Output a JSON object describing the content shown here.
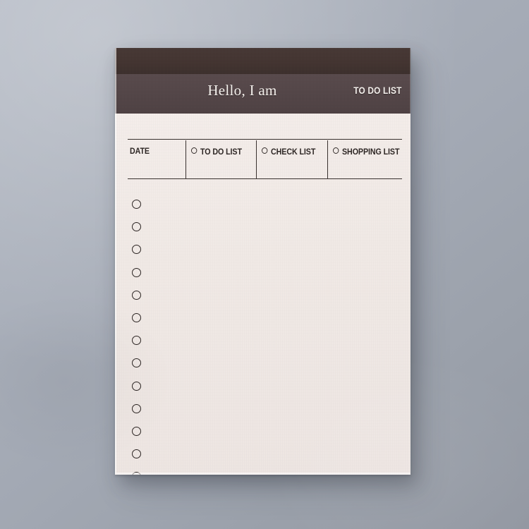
{
  "scene": {
    "background_top_color": "#b1b7c2",
    "background_bottom_color": "#9398a2",
    "surface_description": "gray studio backdrop"
  },
  "notepad": {
    "paper_color": "#efe8e5",
    "header": {
      "band_top_color": "#42332f",
      "band_bottom_color": "#534547",
      "title": "Hello, I am",
      "badge": "TO DO LIST"
    },
    "table": {
      "columns": [
        {
          "label": "DATE",
          "has_bullet": false
        },
        {
          "label": "TO DO LIST",
          "has_bullet": true
        },
        {
          "label": "CHECK LIST",
          "has_bullet": true
        },
        {
          "label": "SHOPPING LIST",
          "has_bullet": true
        }
      ]
    },
    "checklist": {
      "bullet_count": 13,
      "bullet_color": "#2b2422",
      "items": [
        "",
        "",
        "",
        "",
        "",
        "",
        "",
        "",
        "",
        "",
        "",
        "",
        ""
      ]
    }
  }
}
